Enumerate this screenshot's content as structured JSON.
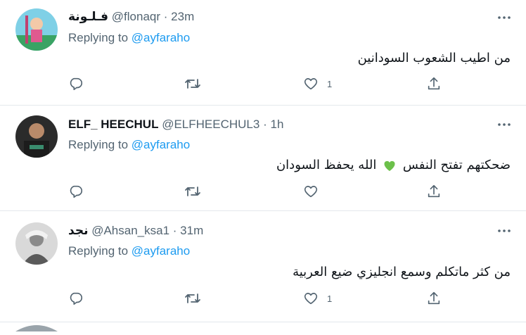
{
  "tweets": [
    {
      "display_name": "فـلـونة",
      "handle": "@flonaqr",
      "separator": "·",
      "time": "23m",
      "replying_prefix": "Replying to ",
      "replying_to": "@ayfaraho",
      "text": "من اطيب الشعوب السودانين",
      "reply_count": "",
      "retweet_count": "",
      "like_count": "1"
    },
    {
      "display_name": "ELF_ HEECHUL",
      "handle": "@ELFHEECHUL3",
      "separator": "·",
      "time": "1h",
      "replying_prefix": "Replying to ",
      "replying_to": "@ayfaraho",
      "text_before": "ضحكتهم تفتح النفس",
      "text_after": "الله يحفظ السودان",
      "reply_count": "",
      "retweet_count": "",
      "like_count": ""
    },
    {
      "display_name": "نجد",
      "handle": "@Ahsan_ksa1",
      "separator": "·",
      "time": "31m",
      "replying_prefix": "Replying to ",
      "replying_to": "@ayfaraho",
      "text": "من كثر ماتكلم وسمع انجليزي ضيع العربية",
      "reply_count": "",
      "retweet_count": "",
      "like_count": "1"
    }
  ],
  "colors": {
    "link": "#1d9bf0",
    "secondary": "#536471",
    "divider": "#e3e8ec",
    "green_heart": "#6cc04a"
  },
  "icons": {
    "reply": "reply-icon",
    "retweet": "retweet-icon",
    "like": "heart-icon",
    "share": "share-icon",
    "more": "more-icon"
  }
}
